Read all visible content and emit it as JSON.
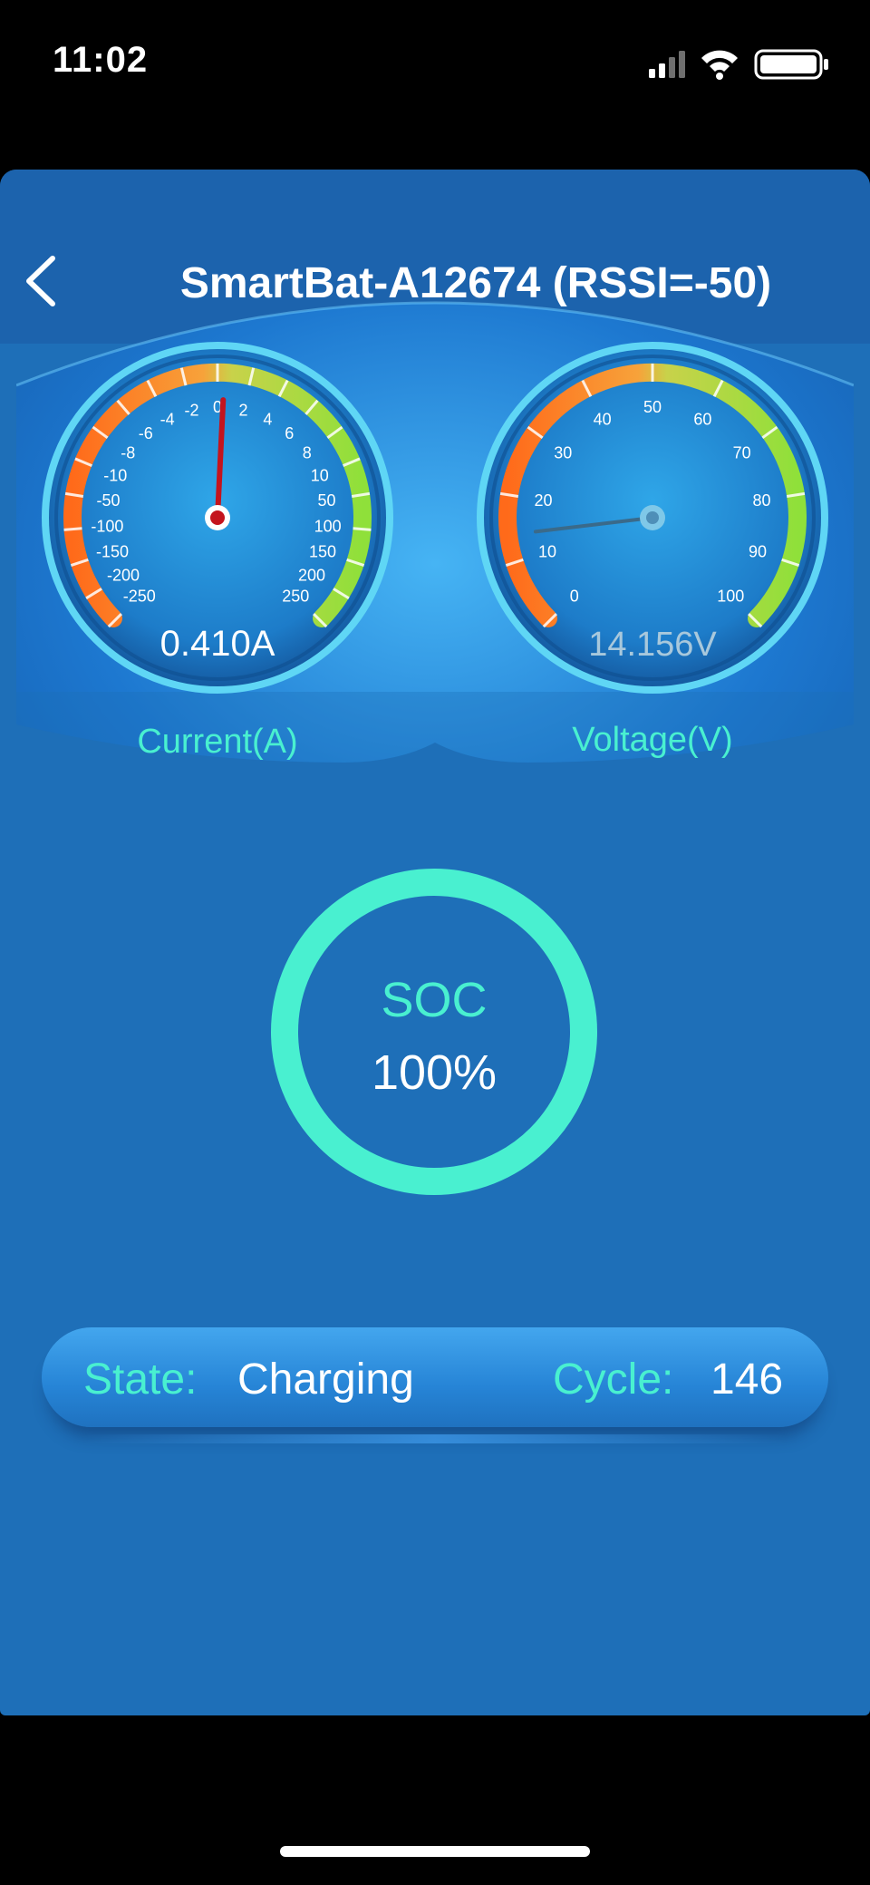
{
  "status_bar": {
    "time": "11:02",
    "icons": [
      "signal-icon",
      "wifi-icon",
      "battery-icon"
    ]
  },
  "nav": {
    "title": "SmartBat-A12674 (RSSI=-50)",
    "back_icon": "chevron-left-icon"
  },
  "current_gauge": {
    "label": "Current(A)",
    "reading": "0.410A",
    "value": 0.41,
    "ticks": [
      "-250",
      "-200",
      "-150",
      "-100",
      "-50",
      "-10",
      "-8",
      "-6",
      "-4",
      "-2",
      "0",
      "2",
      "4",
      "6",
      "8",
      "10",
      "50",
      "100",
      "150",
      "200",
      "250"
    ]
  },
  "voltage_gauge": {
    "label": "Voltage(V)",
    "reading": "14.156V",
    "value": 14.156,
    "ticks": [
      "0",
      "10",
      "20",
      "30",
      "40",
      "50",
      "60",
      "70",
      "80",
      "90",
      "100"
    ]
  },
  "soc": {
    "title": "SOC",
    "value": "100%",
    "percent": 100
  },
  "info": {
    "state_label": "State:",
    "state_value": "Charging",
    "cycle_label": "Cycle:",
    "cycle_value": "146"
  },
  "colors": {
    "background": "#1e6fb8",
    "nav": "#1c63ad",
    "accent": "#49f0d0",
    "gauge_low": "#ff6a1a",
    "gauge_high": "#8fe03a"
  }
}
